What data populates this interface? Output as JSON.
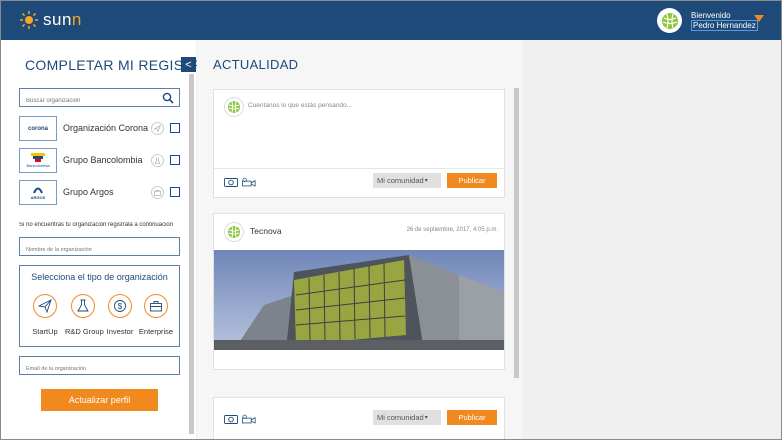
{
  "brand": {
    "name_prefix": "sun",
    "name_suffix": "n",
    "accent": "#f08a1e",
    "primary": "#1e4a7a"
  },
  "user": {
    "greeting": "Bienvenido",
    "name": "Pedro Hernandez"
  },
  "left": {
    "title": "COMPLETAR MI REGISTRO",
    "collapse": "<",
    "search_placeholder": "Buscar organización",
    "orgs": [
      {
        "logo": "corona",
        "name": "Organización Corona",
        "icon": "paper-plane-icon"
      },
      {
        "logo": "Bancolombia",
        "name": "Grupo Bancolombia",
        "icon": "flask-icon"
      },
      {
        "logo": "ARGOS",
        "name": "Grupo Argos",
        "icon": "briefcase-icon"
      }
    ],
    "hint": "Si no encuentras tu organización registrala a continuación",
    "org_name_placeholder": "Nombre de la organización",
    "type_title": "Selecciona el tipo de organización",
    "types": [
      {
        "label": "StartUp",
        "icon": "paper-plane-icon"
      },
      {
        "label": "R&D Group",
        "icon": "flask-icon"
      },
      {
        "label": "Investor",
        "icon": "dollar-icon"
      },
      {
        "label": "Enterprise",
        "icon": "briefcase-icon"
      }
    ],
    "email_placeholder": "Email de la organización",
    "update_button": "Actualizar perfil"
  },
  "center": {
    "title": "ACTUALIDAD",
    "composer_placeholder": "Cuentanos lo que estás pensando...",
    "community": "Mi comunidad",
    "publish": "Publicar",
    "post": {
      "author": "Tecnova",
      "date": "26 de septiembre, 2017, 4:05 p.m."
    }
  }
}
